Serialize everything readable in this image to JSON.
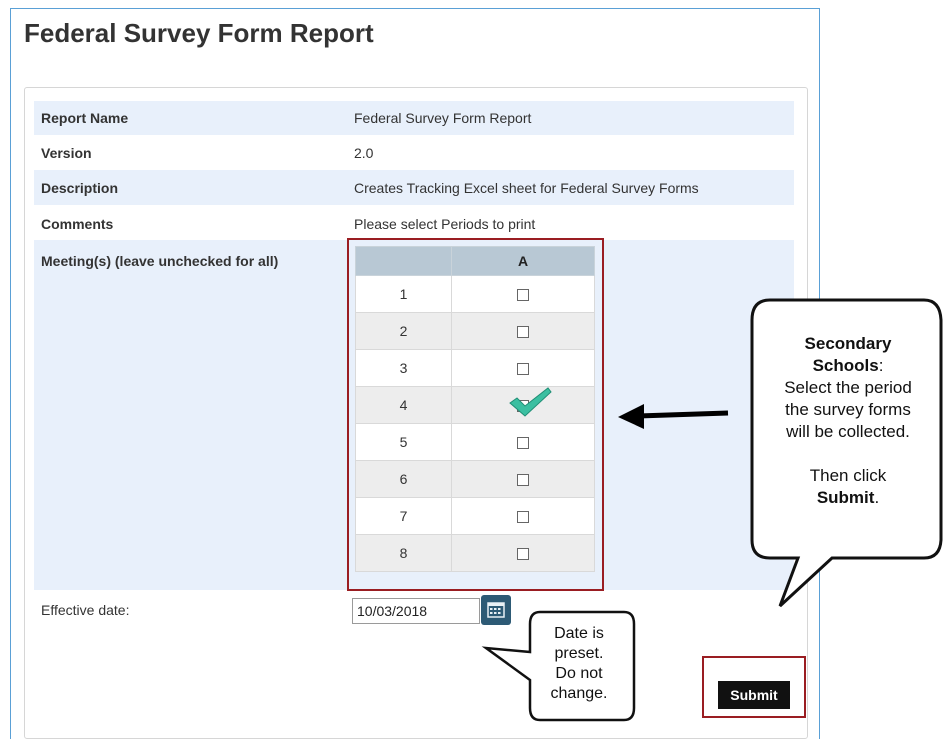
{
  "page_title": "Federal Survey Form Report",
  "rows": [
    {
      "label": "Report Name",
      "value": "Federal Survey Form Report"
    },
    {
      "label": "Version",
      "value": "2.0"
    },
    {
      "label": "Description",
      "value": "Creates Tracking Excel sheet for Federal Survey Forms"
    },
    {
      "label": "Comments",
      "value": "Please select Periods to print"
    }
  ],
  "meetings": {
    "label": "Meeting(s) (leave unchecked for all)",
    "column_header": "A",
    "periods": [
      "1",
      "2",
      "3",
      "4",
      "5",
      "6",
      "7",
      "8"
    ],
    "checked_period": "4"
  },
  "effective_date": {
    "label": "Effective date:",
    "value": "10/03/2018"
  },
  "submit_label": "Submit",
  "callout_secondary": {
    "line1": "Secondary",
    "line2": "Schools",
    "line2_suffix": ":",
    "line3": "Select the period",
    "line4": "the survey forms",
    "line5": "will be collected.",
    "line6": "Then click",
    "line7": "Submit",
    "line7_suffix": "."
  },
  "callout_date": {
    "line1": "Date is",
    "line2": "preset.",
    "line3": "Do not",
    "line4": "change."
  },
  "icons": {
    "calendar": "calendar-icon",
    "checkmark": "checkmark-icon",
    "arrow": "left-arrow-icon"
  },
  "colors": {
    "highlight_border": "#9a1d22",
    "row_shade": "#e8f0fb",
    "calendar_button": "#2d5a75",
    "checkmark": "#3bbfa1"
  }
}
